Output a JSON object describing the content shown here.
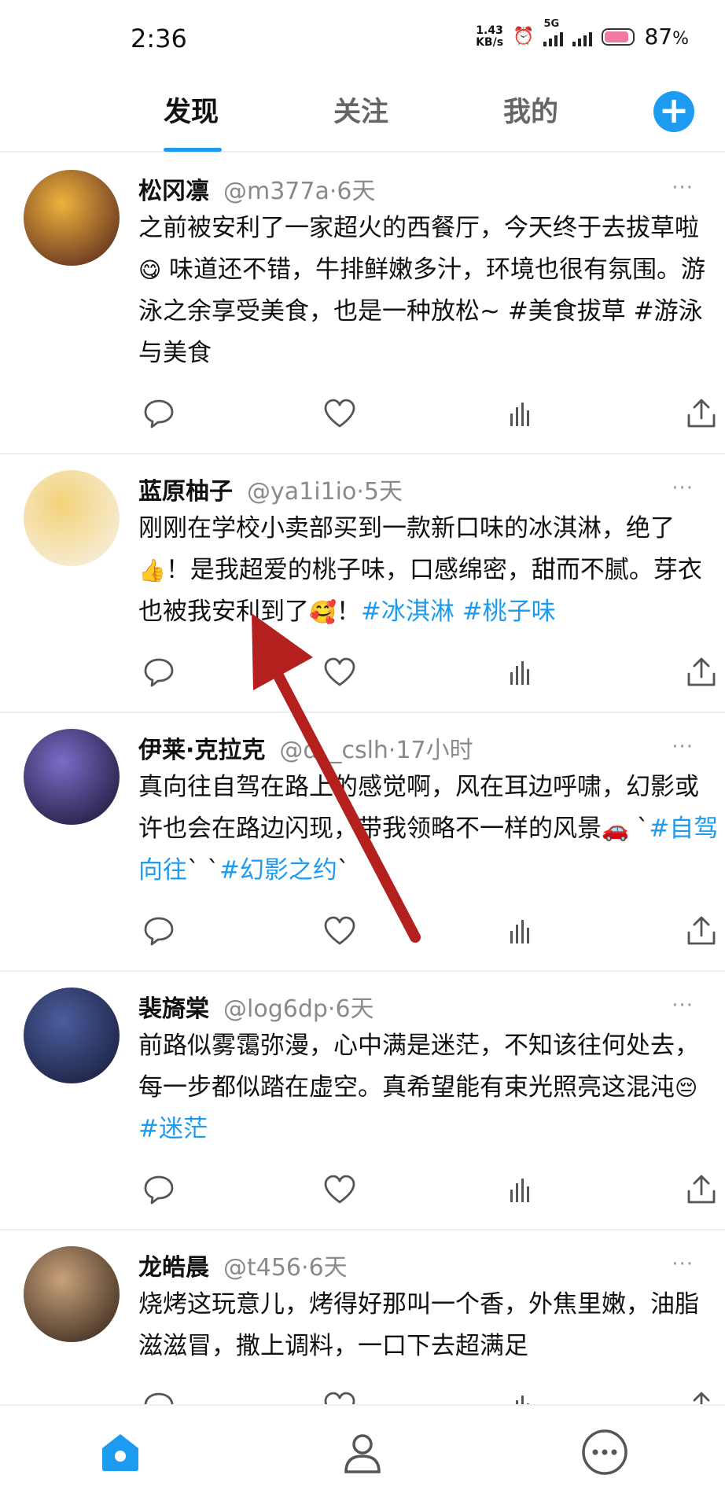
{
  "status_bar": {
    "time": "2:36",
    "net_speed_value": "1.43",
    "net_speed_unit": "KB/s",
    "signal_label": "5G",
    "battery_percent": "87",
    "battery_unit": "%",
    "battery_level": 0.87
  },
  "tabs": [
    {
      "label": "发现",
      "active": true
    },
    {
      "label": "关注",
      "active": false
    },
    {
      "label": "我的",
      "active": false
    }
  ],
  "add_button": "+",
  "posts": [
    {
      "name": "松冈凛",
      "handle": "@m377a",
      "sep": "·",
      "time": "6天",
      "segments": [
        {
          "t": "之前被安利了一家超火的西餐厅，今天终于去拔草啦"
        },
        {
          "t": "😋",
          "e": true
        },
        {
          "t": " 味道还不错，牛排鲜嫩多汁，环境也很有氛围。游泳之余享受美食，也是一种放松~ #美食拔草 #游泳与美食"
        }
      ],
      "avatar_colors": [
        "#f0b23c",
        "#5a2b1f"
      ]
    },
    {
      "name": "蓝原柚子",
      "handle": "@ya1i1io",
      "sep": "·",
      "time": "5天",
      "segments": [
        {
          "t": "刚刚在学校小卖部买到一款新口味的冰淇淋，绝了"
        },
        {
          "t": "👍",
          "e": true
        },
        {
          "t": "！是我超爱的桃子味，口感绵密，甜而不腻。芽衣也被我安利到了"
        },
        {
          "t": "🥰",
          "e": true
        },
        {
          "t": "！"
        },
        {
          "t": "#冰淇淋 #桃子味",
          "h": true
        }
      ],
      "avatar_colors": [
        "#f3d27a",
        "#f7f0e0"
      ]
    },
    {
      "name": "伊莱·克拉克",
      "handle": "@d__cslh",
      "sep": "·",
      "time": "17小时",
      "segments": [
        {
          "t": "真向往自驾在路上的感觉啊，风在耳边呼啸，幻影或许也会在路边闪现，带我领略不一样的风景"
        },
        {
          "t": "🚗",
          "e": true
        },
        {
          "t": " `"
        },
        {
          "t": "#自驾向往",
          "h": true
        },
        {
          "t": "` `"
        },
        {
          "t": "#幻影之约",
          "h": true
        },
        {
          "t": "`"
        }
      ],
      "avatar_colors": [
        "#7a6cc8",
        "#1d1b3a"
      ]
    },
    {
      "name": "裴旖棠",
      "handle": "@log6dp",
      "sep": "·",
      "time": "6天",
      "segments": [
        {
          "t": "前路似雾霭弥漫，心中满是迷茫，不知该往何处去，每一步都似踏在虚空。真希望能有束光照亮这混沌"
        },
        {
          "t": "😔",
          "e": true
        },
        {
          "t": " "
        },
        {
          "t": "#迷茫",
          "h": true
        }
      ],
      "avatar_colors": [
        "#4a5d9e",
        "#1a1f3c"
      ]
    },
    {
      "name": "龙皓晨",
      "handle": "@t456",
      "sep": "·",
      "time": "6天",
      "segments": [
        {
          "t": "烧烤这玩意儿，烤得好那叫一个香，外焦里嫩，油脂滋滋冒，撒上调料，一口下去超满足"
        }
      ],
      "avatar_colors": [
        "#c9a27a",
        "#3a2a1e"
      ]
    }
  ],
  "icons": {
    "reply": "comment-icon",
    "like": "heart-icon",
    "views": "bar-chart-icon",
    "share": "share-icon",
    "more": "more-dots-icon",
    "home": "home-icon",
    "profile": "profile-icon",
    "more_nav": "more-circle-icon"
  },
  "more_glyph": "···",
  "colors": {
    "accent": "#1d9bf0",
    "annotation_arrow": "#b3201e"
  }
}
